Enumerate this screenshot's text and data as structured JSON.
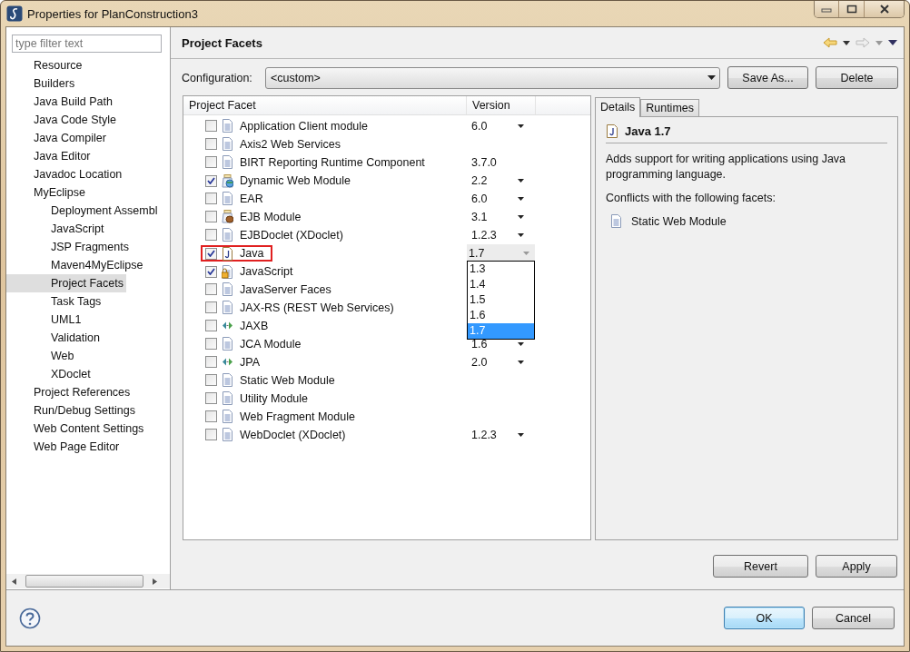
{
  "window": {
    "title": "Properties for PlanConstruction3"
  },
  "filter": {
    "placeholder": "type filter text"
  },
  "tree": [
    {
      "label": "Resource",
      "selected": false
    },
    {
      "label": "Builders",
      "selected": false
    },
    {
      "label": "Java Build Path",
      "selected": false
    },
    {
      "label": "Java Code Style",
      "selected": false
    },
    {
      "label": "Java Compiler",
      "selected": false
    },
    {
      "label": "Java Editor",
      "selected": false
    },
    {
      "label": "Javadoc Location",
      "selected": false
    },
    {
      "label": "MyEclipse",
      "selected": false,
      "children": [
        {
          "label": "Deployment Assembl",
          "selected": false
        },
        {
          "label": "JavaScript",
          "selected": false
        },
        {
          "label": "JSP Fragments",
          "selected": false
        },
        {
          "label": "Maven4MyEclipse",
          "selected": false
        },
        {
          "label": "Project Facets",
          "selected": true
        },
        {
          "label": "Task Tags",
          "selected": false
        },
        {
          "label": "UML1",
          "selected": false
        },
        {
          "label": "Validation",
          "selected": false
        },
        {
          "label": "Web",
          "selected": false
        },
        {
          "label": "XDoclet",
          "selected": false
        }
      ]
    },
    {
      "label": "Project References",
      "selected": false
    },
    {
      "label": "Run/Debug Settings",
      "selected": false
    },
    {
      "label": "Web Content Settings",
      "selected": false
    },
    {
      "label": "Web Page Editor",
      "selected": false
    }
  ],
  "page_title": "Project Facets",
  "configuration": {
    "label": "Configuration:",
    "value": "<custom>"
  },
  "config_buttons": [
    "Save As...",
    "Delete"
  ],
  "table": {
    "columns": [
      "Project Facet",
      "Version"
    ],
    "rows": [
      {
        "name": "Application Client module",
        "checked": false,
        "kind": "doc",
        "version": "6.0",
        "dropdown": true
      },
      {
        "name": "Axis2 Web Services",
        "checked": false,
        "kind": "doc"
      },
      {
        "name": "BIRT Reporting Runtime Component",
        "checked": false,
        "kind": "doc",
        "version": "3.7.0"
      },
      {
        "name": "Dynamic Web Module",
        "checked": true,
        "kind": "web",
        "version": "2.2",
        "dropdown": true
      },
      {
        "name": "EAR",
        "checked": false,
        "kind": "doc",
        "version": "6.0",
        "dropdown": true
      },
      {
        "name": "EJB Module",
        "checked": false,
        "kind": "ejb",
        "version": "3.1",
        "dropdown": true
      },
      {
        "name": "EJBDoclet (XDoclet)",
        "checked": false,
        "kind": "doc",
        "version": "1.2.3",
        "dropdown": true
      },
      {
        "name": "Java",
        "checked": true,
        "kind": "java",
        "version": "1.7",
        "dropdown": true,
        "editing": true,
        "highlighted": true
      },
      {
        "name": "JavaScript",
        "checked": true,
        "kind": "locked"
      },
      {
        "name": "JavaServer Faces",
        "checked": false,
        "kind": "doc"
      },
      {
        "name": "JAX-RS (REST Web Services)",
        "checked": false,
        "kind": "doc"
      },
      {
        "name": "JAXB",
        "checked": false,
        "kind": "binding"
      },
      {
        "name": "JCA Module",
        "checked": false,
        "kind": "doc",
        "version": "1.6",
        "dropdown": true
      },
      {
        "name": "JPA",
        "checked": false,
        "kind": "binding",
        "version": "2.0",
        "dropdown": true
      },
      {
        "name": "Static Web Module",
        "checked": false,
        "kind": "doc"
      },
      {
        "name": "Utility Module",
        "checked": false,
        "kind": "doc"
      },
      {
        "name": "Web Fragment Module",
        "checked": false,
        "kind": "doc"
      },
      {
        "name": "WebDoclet (XDoclet)",
        "checked": false,
        "kind": "doc",
        "version": "1.2.3",
        "dropdown": true
      }
    ]
  },
  "version_list": {
    "options": [
      {
        "label": "1.3",
        "selected": false
      },
      {
        "label": "1.4",
        "selected": false
      },
      {
        "label": "1.5",
        "selected": false
      },
      {
        "label": "1.6",
        "selected": false
      },
      {
        "label": "1.7",
        "selected": true
      }
    ]
  },
  "details": {
    "tabs": [
      {
        "label": "Details",
        "selected": true
      },
      {
        "label": "Runtimes",
        "selected": false
      }
    ],
    "title": "Java 1.7",
    "description": "Adds support for writing applications using Java programming language.",
    "conflicts_label": "Conflicts with the following facets:",
    "conflicts": [
      "Static Web Module"
    ]
  },
  "page_buttons": [
    "Revert",
    "Apply"
  ],
  "dialog_buttons": [
    {
      "label": "OK",
      "default": true
    },
    {
      "label": "Cancel",
      "default": false
    }
  ]
}
